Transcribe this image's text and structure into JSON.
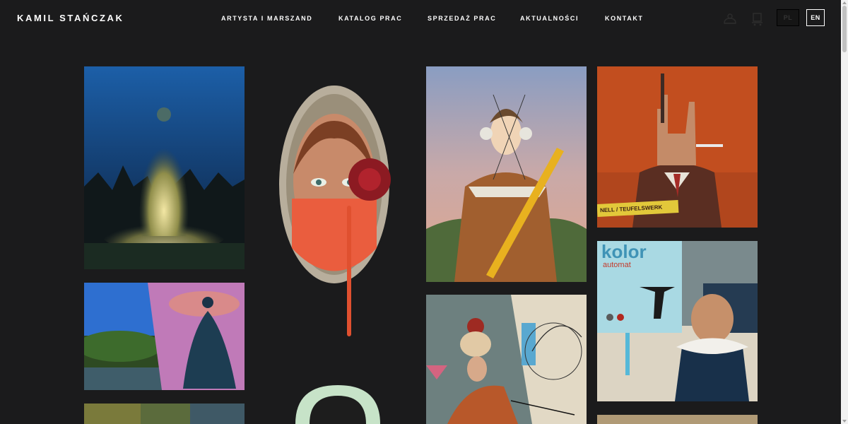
{
  "header": {
    "logo": "KAMIL STAŃCZAK",
    "nav": [
      "ARTYSTA I MARSZAND",
      "KATALOG PRAC",
      "SPRZEDAŻ PRAC",
      "AKTUALNOŚCI",
      "KONTAKT"
    ],
    "lang_pl": "PL",
    "lang_en": "EN"
  },
  "gallery": {
    "texts": {
      "tape_label": "NELL / TEUFELSWERK",
      "kolor": "kolor",
      "automat": "automat"
    }
  },
  "colors": {
    "background": "#1b1b1c",
    "text": "#ffffff"
  }
}
